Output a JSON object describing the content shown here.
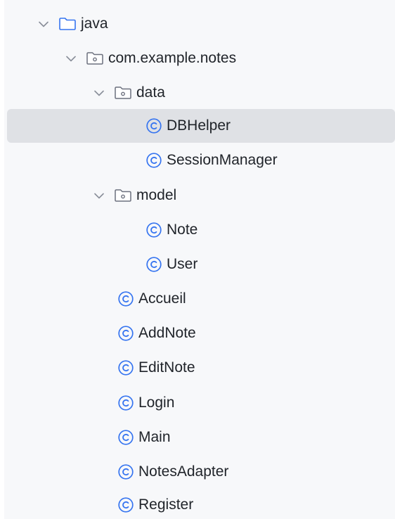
{
  "tree": {
    "java": {
      "label": "java",
      "icon": "folder-icon"
    },
    "package": {
      "label": "com.example.notes",
      "icon": "package-icon"
    },
    "data_pkg": {
      "label": "data",
      "icon": "package-icon"
    },
    "dbhelper": {
      "label": "DBHelper",
      "icon": "class-icon"
    },
    "sessionmanager": {
      "label": "SessionManager",
      "icon": "class-icon"
    },
    "model_pkg": {
      "label": "model",
      "icon": "package-icon"
    },
    "note": {
      "label": "Note",
      "icon": "class-icon"
    },
    "user": {
      "label": "User",
      "icon": "class-icon"
    },
    "accueil": {
      "label": "Accueil",
      "icon": "class-icon"
    },
    "addnote": {
      "label": "AddNote",
      "icon": "class-icon"
    },
    "editnote": {
      "label": "EditNote",
      "icon": "class-icon"
    },
    "login": {
      "label": "Login",
      "icon": "class-icon"
    },
    "main": {
      "label": "Main",
      "icon": "class-icon"
    },
    "notesadapter": {
      "label": "NotesAdapter",
      "icon": "class-icon"
    },
    "register": {
      "label": "Register",
      "icon": "class-icon"
    }
  },
  "colors": {
    "folder_stroke": "#3574f0",
    "package_stroke": "#6c707e",
    "class_stroke": "#3574f0",
    "selection_bg": "#dfe1e5",
    "chevron": "#8a8f9a"
  }
}
